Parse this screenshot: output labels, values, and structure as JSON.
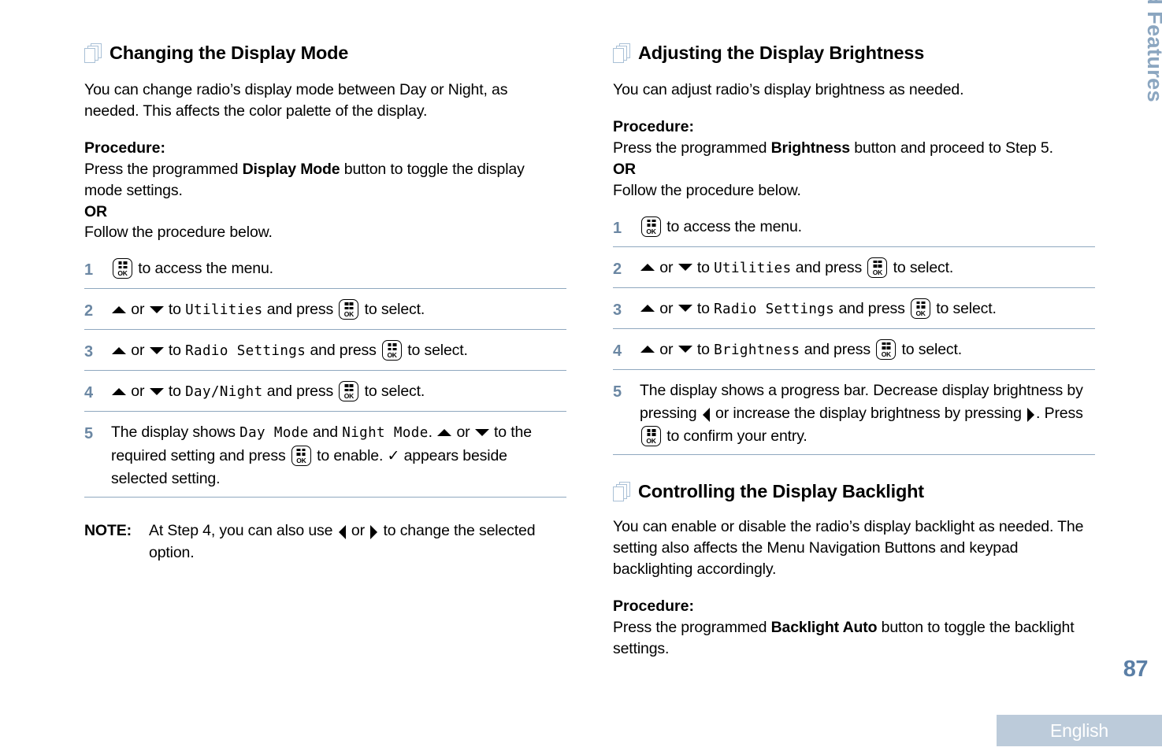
{
  "rail": {
    "chapter_title": "Advanced Features",
    "page_number": "87",
    "language_tab": "English",
    "accent_color": "#8ba6c0",
    "tab_background": "#bccbda",
    "step_number_color": "#6b87a3",
    "rule_color": "#8fa8bf"
  },
  "sections": {
    "display_mode": {
      "title": "Changing the Display Mode",
      "intro": "You can change radio’s display mode between Day or Night, as needed. This affects the color palette of the display.",
      "procedure_label": "Procedure:",
      "procedure_line1_pre": "Press the programmed ",
      "procedure_line1_bold": "Display Mode",
      "procedure_line1_post": " button to toggle the display mode settings.",
      "or": "OR",
      "follow": "Follow the procedure below.",
      "steps": [
        {
          "num": "1",
          "text_after_key": " to access the menu."
        },
        {
          "num": "2",
          "pre": " or ",
          "mid": " to ",
          "menu": "Utilities",
          "post": " and press ",
          "tail": " to select."
        },
        {
          "num": "3",
          "pre": " or ",
          "mid": " to ",
          "menu": "Radio Settings",
          "post": " and press ",
          "tail": " to select."
        },
        {
          "num": "4",
          "pre": " or ",
          "mid": " to ",
          "menu": "Day/Night",
          "post": " and press ",
          "tail": " to select."
        },
        {
          "num": "5",
          "a": "The display shows ",
          "menu_a": "Day Mode",
          "b": " and ",
          "menu_b": "Night Mode",
          "c": ". ",
          "d": " or ",
          "e": " to the required setting and press ",
          "f": " to enable. ",
          "check": "✓",
          "g": " appears beside selected setting."
        }
      ],
      "note_label": "NOTE:",
      "note_a": "At Step 4, you can also use ",
      "note_b": " or ",
      "note_c": " to change the selected option."
    },
    "brightness": {
      "title": "Adjusting the Display Brightness",
      "intro": "You can adjust radio’s display brightness as needed.",
      "procedure_label": "Procedure:",
      "procedure_line1_pre": "Press the programmed ",
      "procedure_line1_bold": "Brightness",
      "procedure_line1_post": " button and proceed to Step 5.",
      "or": "OR",
      "follow": "Follow the procedure below.",
      "steps": [
        {
          "num": "1",
          "text_after_key": " to access the menu."
        },
        {
          "num": "2",
          "pre": " or ",
          "mid": " to ",
          "menu": "Utilities",
          "post": " and press ",
          "tail": " to select."
        },
        {
          "num": "3",
          "pre": " or ",
          "mid": " to ",
          "menu": "Radio Settings",
          "post": " and press ",
          "tail": " to select."
        },
        {
          "num": "4",
          "pre": " or ",
          "mid": " to ",
          "menu": "Brightness",
          "post": " and press ",
          "tail": " to select."
        },
        {
          "num": "5",
          "a": "The display shows a progress bar. Decrease display brightness by pressing ",
          "b": " or increase the display brightness by pressing ",
          "c": ". Press ",
          "d": " to confirm your entry."
        }
      ]
    },
    "backlight": {
      "title": "Controlling the Display Backlight",
      "intro": "You can enable or disable the radio’s display backlight as needed. The setting also affects the Menu Navigation Buttons and keypad backlighting accordingly.",
      "procedure_label": "Procedure:",
      "procedure_line1_pre": "Press the programmed ",
      "procedure_line1_bold": "Backlight Auto",
      "procedure_line1_post": " button to toggle the backlight settings."
    }
  },
  "icons": {
    "section": "stacked-pages-icon",
    "menu_key": "ok-menu-key-icon",
    "up": "arrow-up-icon",
    "down": "arrow-down-icon",
    "left": "arrow-left-icon",
    "right": "arrow-right-icon",
    "check": "checkmark-icon"
  }
}
